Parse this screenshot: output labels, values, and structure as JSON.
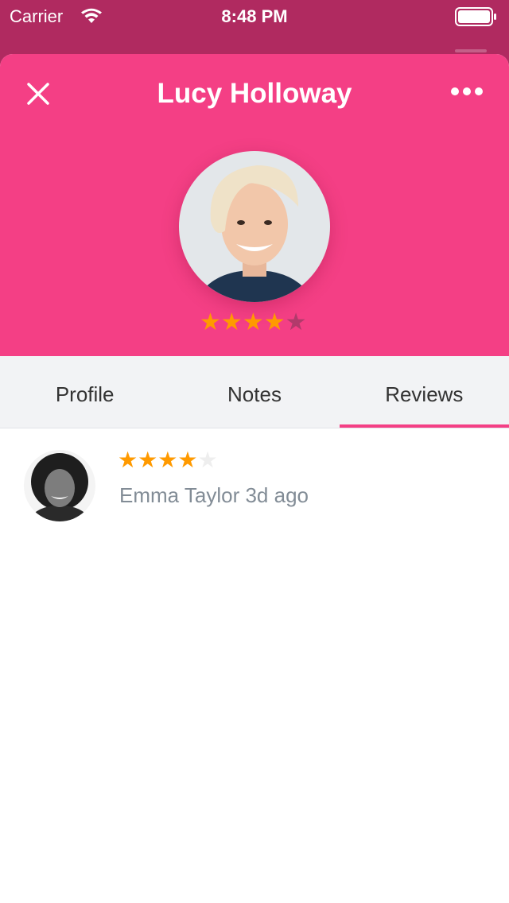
{
  "status_bar": {
    "carrier": "Carrier",
    "time": "8:48 PM"
  },
  "header": {
    "title": "Lucy Holloway",
    "close_icon": "close-icon",
    "more_icon": "more-icon",
    "rating": 4,
    "rating_max": 5
  },
  "tabs": [
    {
      "label": "Profile",
      "active": false
    },
    {
      "label": "Notes",
      "active": false
    },
    {
      "label": "Reviews",
      "active": true
    }
  ],
  "reviews": [
    {
      "rating": 4,
      "rating_max": 5,
      "author": "Emma Taylor",
      "age": "3d ago"
    }
  ],
  "colors": {
    "accent": "#f43f85",
    "status_bar": "#b02a60",
    "star_filled": "#ff9a00",
    "star_empty_header": "#b13a6b",
    "star_empty_list": "#eeeeee",
    "meta_text": "#828c96"
  }
}
